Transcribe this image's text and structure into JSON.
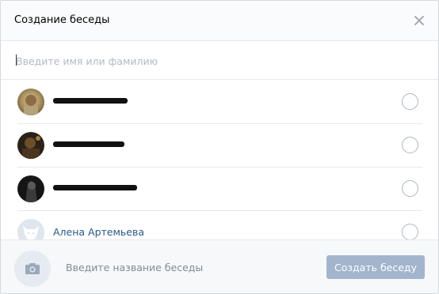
{
  "dialog": {
    "title": "Создание беседы"
  },
  "search": {
    "placeholder": "Введите имя или фамилию",
    "value": ""
  },
  "friends": [
    {
      "name": "",
      "redacted": true
    },
    {
      "name": "",
      "redacted": true
    },
    {
      "name": "",
      "redacted": true
    },
    {
      "name": "Алена Артемьева",
      "redacted": false
    }
  ],
  "footer": {
    "chat_name_placeholder": "Введите название беседы",
    "create_label": "Создать беседу"
  },
  "colors": {
    "link": "#2a5885",
    "button": "#a2b5cd",
    "border": "#e7e8ec"
  }
}
